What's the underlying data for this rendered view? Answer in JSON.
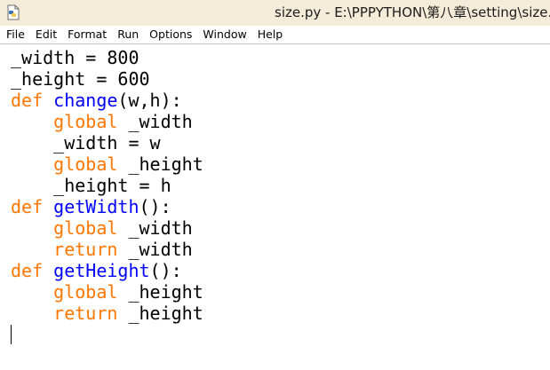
{
  "window": {
    "title": "size.py - E:\\PPPYTHON\\第八章\\setting\\size.p"
  },
  "menu": {
    "items": [
      "File",
      "Edit",
      "Format",
      "Run",
      "Options",
      "Window",
      "Help"
    ]
  },
  "colors": {
    "keyword": "#ff7700",
    "function_name": "#0000ff",
    "text": "#000000",
    "titlebar_bg": "#f4ecd8"
  },
  "icons": {
    "app_icon": "python-file-icon"
  },
  "editor": {
    "lines": [
      [
        {
          "t": "_width = 800",
          "c": "plain"
        }
      ],
      [
        {
          "t": "_height = 600",
          "c": "plain"
        }
      ],
      [
        {
          "t": "def",
          "c": "kw-def"
        },
        {
          "t": " ",
          "c": "plain"
        },
        {
          "t": "change",
          "c": "fn-name"
        },
        {
          "t": "(w,h):",
          "c": "plain"
        }
      ],
      [
        {
          "t": "    ",
          "c": "plain"
        },
        {
          "t": "global",
          "c": "kw-orange"
        },
        {
          "t": " _width",
          "c": "plain"
        }
      ],
      [
        {
          "t": "    _width = w",
          "c": "plain"
        }
      ],
      [
        {
          "t": "    ",
          "c": "plain"
        },
        {
          "t": "global",
          "c": "kw-orange"
        },
        {
          "t": " _height",
          "c": "plain"
        }
      ],
      [
        {
          "t": "    _height = h",
          "c": "plain"
        }
      ],
      [
        {
          "t": "def",
          "c": "kw-def"
        },
        {
          "t": " ",
          "c": "plain"
        },
        {
          "t": "getWidth",
          "c": "fn-name"
        },
        {
          "t": "():",
          "c": "plain"
        }
      ],
      [
        {
          "t": "    ",
          "c": "plain"
        },
        {
          "t": "global",
          "c": "kw-orange"
        },
        {
          "t": " _width",
          "c": "plain"
        }
      ],
      [
        {
          "t": "    ",
          "c": "plain"
        },
        {
          "t": "return",
          "c": "kw-orange"
        },
        {
          "t": " _width",
          "c": "plain"
        }
      ],
      [
        {
          "t": "def",
          "c": "kw-def"
        },
        {
          "t": " ",
          "c": "plain"
        },
        {
          "t": "getHeight",
          "c": "fn-name"
        },
        {
          "t": "():",
          "c": "plain"
        }
      ],
      [
        {
          "t": "    ",
          "c": "plain"
        },
        {
          "t": "global",
          "c": "kw-orange"
        },
        {
          "t": " _height",
          "c": "plain"
        }
      ],
      [
        {
          "t": "    ",
          "c": "plain"
        },
        {
          "t": "return",
          "c": "kw-orange"
        },
        {
          "t": " _height",
          "c": "plain"
        }
      ]
    ]
  }
}
